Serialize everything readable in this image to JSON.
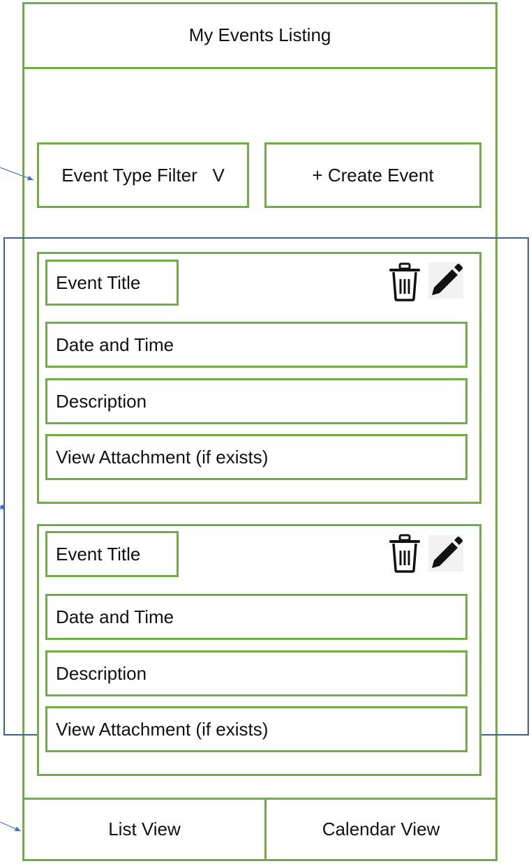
{
  "header": {
    "title": "My Events Listing"
  },
  "toolbar": {
    "filter_label": "Event Type Filter   V",
    "create_label": "+ Create Event"
  },
  "events": [
    {
      "title": "Event Title",
      "datetime": "Date and Time",
      "description": "Description",
      "attachment": "View Attachment (if exists)"
    },
    {
      "title": "Event Title",
      "datetime": "Date and Time",
      "description": "Description",
      "attachment": "View Attachment (if exists)"
    }
  ],
  "footer": {
    "list_view": "List View",
    "calendar_view": "Calendar View"
  },
  "icons": [
    "trash-icon",
    "pencil-icon"
  ],
  "colors": {
    "border_green": "#70ad47",
    "region_blue": "#3f5f8f",
    "arrow_blue": "#4472c4"
  }
}
